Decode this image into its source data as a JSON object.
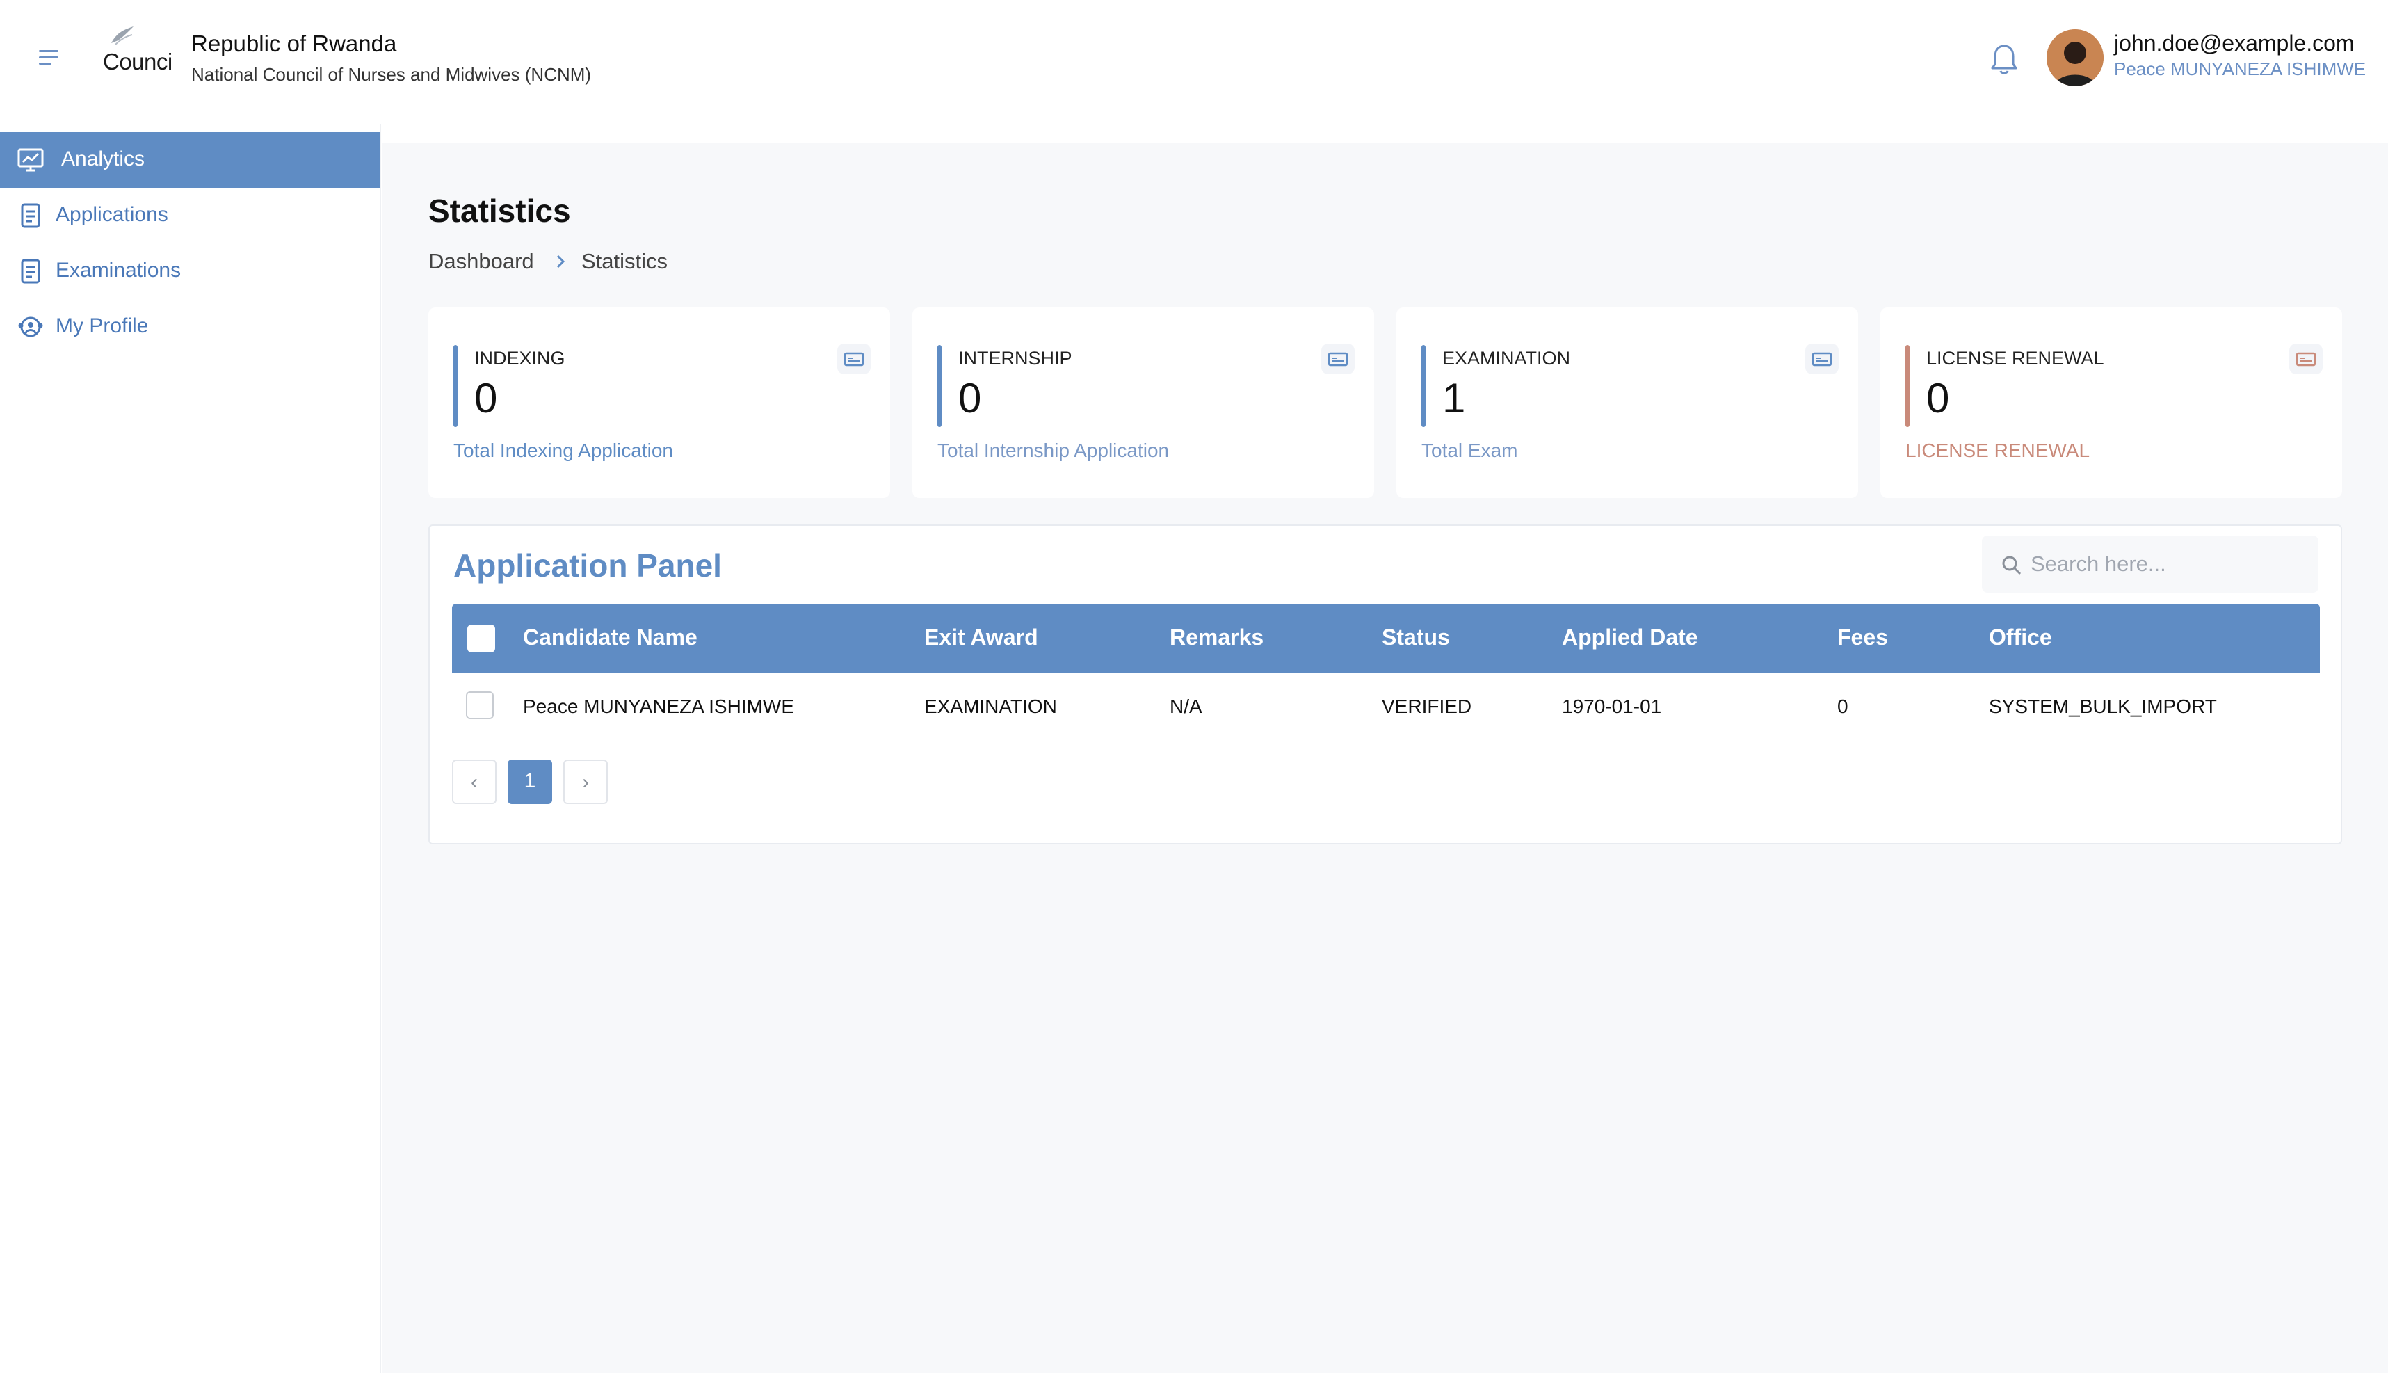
{
  "header": {
    "logo_text": "Counci",
    "org_title": "Republic of Rwanda",
    "org_subtitle": "National Council of Nurses and Midwives (NCNM)",
    "user_email": "john.doe@example.com",
    "user_name": "Peace MUNYANEZA ISHIMWE"
  },
  "sidebar": {
    "items": [
      {
        "label": "Analytics",
        "icon": "monitor-chart-icon",
        "active": true
      },
      {
        "label": "Applications",
        "icon": "document-icon",
        "active": false
      },
      {
        "label": "Examinations",
        "icon": "document-icon",
        "active": false
      },
      {
        "label": "My Profile",
        "icon": "profile-group-icon",
        "active": false
      }
    ]
  },
  "page": {
    "title": "Statistics",
    "breadcrumb": [
      "Dashboard",
      "Statistics"
    ]
  },
  "stats": [
    {
      "category": "INDEXING",
      "value": "0",
      "description": "Total Indexing Application",
      "accent": "#5f8cc4"
    },
    {
      "category": "INTERNSHIP",
      "value": "0",
      "description": "Total Internship Application",
      "accent": "#5f8cc4"
    },
    {
      "category": "EXAMINATION",
      "value": "1",
      "description": "Total Exam",
      "accent": "#5f8cc4"
    },
    {
      "category": "LICENSE RENEWAL",
      "value": "0",
      "description": "LICENSE RENEWAL",
      "accent": "#c98a7a"
    }
  ],
  "panel": {
    "title": "Application Panel",
    "search_placeholder": "Search here...",
    "columns": [
      "Candidate Name",
      "Exit Award",
      "Remarks",
      "Status",
      "Applied Date",
      "Fees",
      "Office"
    ],
    "rows": [
      [
        "Peace MUNYANEZA ISHIMWE",
        "EXAMINATION",
        "N/A",
        "VERIFIED",
        "1970-01-01",
        "0",
        "SYSTEM_BULK_IMPORT"
      ]
    ],
    "pagination": {
      "prev": "‹",
      "current": "1",
      "next": "›"
    }
  },
  "colors": {
    "brand": "#5f8cc4",
    "license_accent": "#c98a7a",
    "background": "#f7f8fa"
  }
}
